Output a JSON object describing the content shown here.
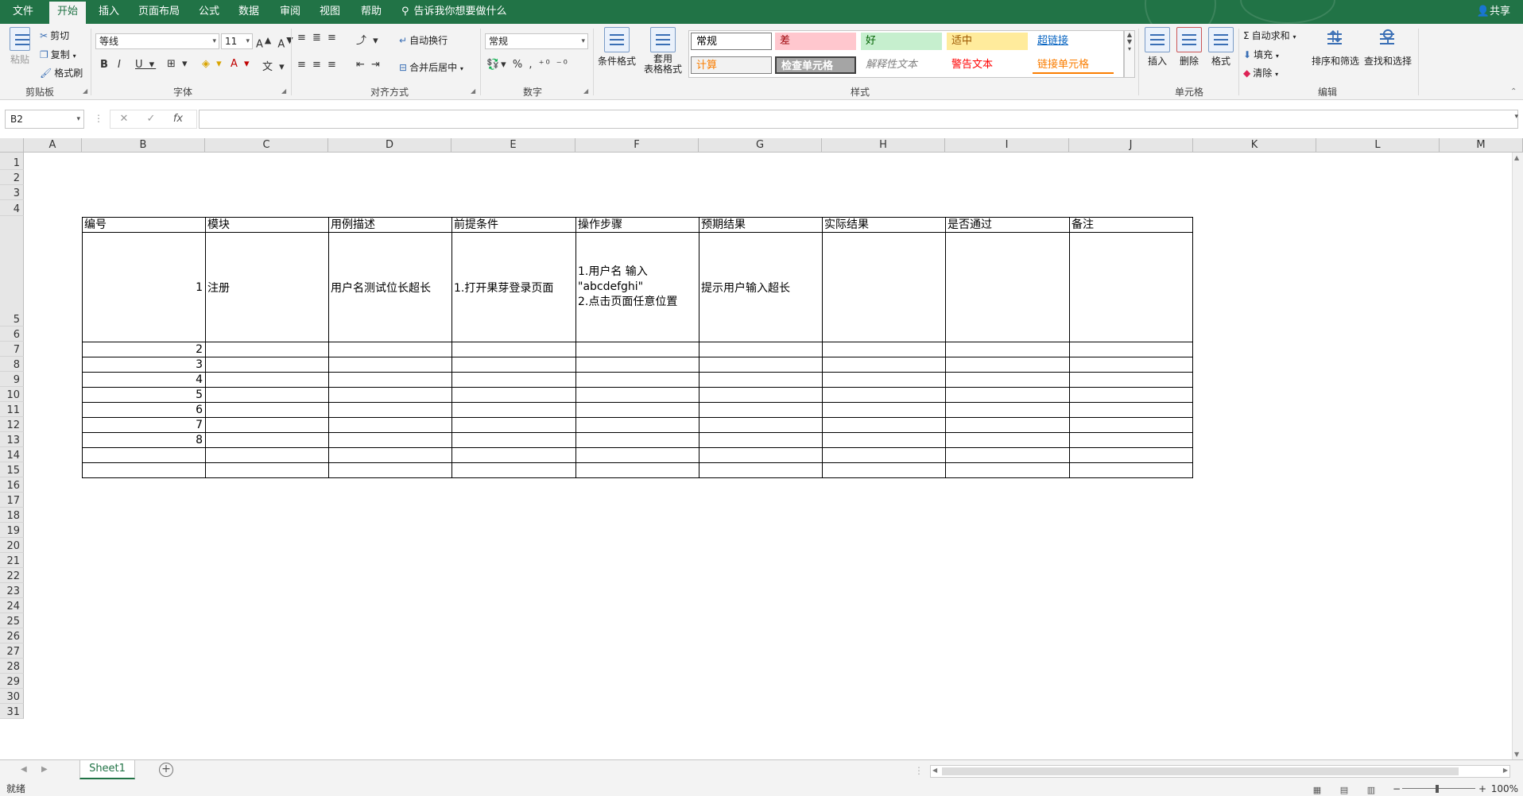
{
  "ribbon_tabs": [
    "文件",
    "开始",
    "插入",
    "页面布局",
    "公式",
    "数据",
    "审阅",
    "视图",
    "帮助"
  ],
  "tell_me": "告诉我你想要做什么",
  "share": "共享",
  "clipboard": {
    "paste": "粘贴",
    "cut": "剪切",
    "copy": "复制",
    "format_painter": "格式刷",
    "label": "剪贴板"
  },
  "font": {
    "name": "等线",
    "size": "11",
    "label": "字体"
  },
  "alignment": {
    "wrap": "自动换行",
    "merge": "合并后居中",
    "label": "对齐方式"
  },
  "number": {
    "format": "常规",
    "label": "数字"
  },
  "styles": {
    "conditional": "条件格式",
    "table_line1": "套用",
    "table_line2": "表格格式",
    "label": "样式",
    "gallery": [
      {
        "text": "常规",
        "bg": "#ffffff",
        "fg": "#000000"
      },
      {
        "text": "差",
        "bg": "#ffc7ce",
        "fg": "#9c0006"
      },
      {
        "text": "好",
        "bg": "#c6efce",
        "fg": "#006100"
      },
      {
        "text": "适中",
        "bg": "#ffeb9c",
        "fg": "#9c5700"
      },
      {
        "text": "超链接",
        "bg": "#ffffff",
        "fg": "#0563c1"
      },
      {
        "text": "计算",
        "bg": "#f2f2f2",
        "fg": "#fa7d00"
      },
      {
        "text": "检查单元格",
        "bg": "#a5a5a5",
        "fg": "#ffffff"
      },
      {
        "text": "解释性文本",
        "bg": "#ffffff",
        "fg": "#7f7f7f"
      },
      {
        "text": "警告文本",
        "bg": "#ffffff",
        "fg": "#ff0000"
      },
      {
        "text": "链接单元格",
        "bg": "#ffffff",
        "fg": "#fa7d00"
      }
    ]
  },
  "cells_group": {
    "insert": "插入",
    "delete": "删除",
    "format": "格式",
    "label": "单元格"
  },
  "editing": {
    "autosum": "自动求和",
    "fill": "填充",
    "clear": "清除",
    "sort": "排序和筛选",
    "find": "查找和选择",
    "label": "编辑"
  },
  "name_box": "B2",
  "fx": "fx",
  "columns": [
    "A",
    "B",
    "C",
    "D",
    "E",
    "F",
    "G",
    "H",
    "I",
    "J",
    "K",
    "L",
    "M"
  ],
  "rows": [
    "1",
    "2",
    "3",
    "4",
    "5",
    "6",
    "7",
    "8",
    "9",
    "10",
    "11",
    "12",
    "13",
    "14",
    "15",
    "16",
    "17",
    "18",
    "19",
    "20",
    "21",
    "22",
    "23",
    "24",
    "25",
    "26",
    "27",
    "28",
    "29",
    "30",
    "31"
  ],
  "table": {
    "headers": [
      "编号",
      "模块",
      "用例描述",
      "前提条件",
      "操作步骤",
      "预期结果",
      "实际结果",
      "是否通过",
      "备注"
    ],
    "row4": {
      "id": "1",
      "module": "注册",
      "desc": "用户名测试位长超长",
      "precondition": "1.打开果芽登录页面",
      "steps_line1": "1.用户名 输入",
      "steps_line2": "\"abcdefghi\"",
      "steps_line3": "2.点击页面任意位置",
      "expected": "提示用户输入超长"
    },
    "ids": [
      "2",
      "3",
      "4",
      "5",
      "6",
      "7",
      "8"
    ]
  },
  "sheet_tab": "Sheet1",
  "status": {
    "ready": "就绪",
    "zoom": "100%"
  }
}
